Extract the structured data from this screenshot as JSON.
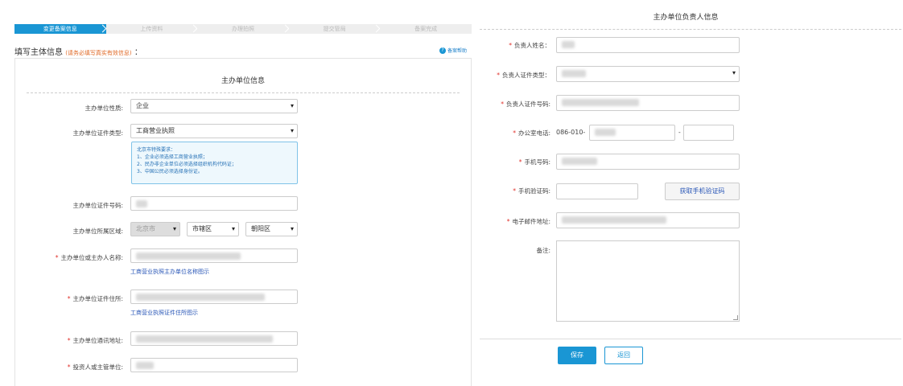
{
  "steps": [
    "变更备案信息",
    "上传资料",
    "办理拍照",
    "提交管局",
    "备案完成"
  ],
  "left": {
    "fill_title": "填写主体信息",
    "fill_hint": "(请务必填写真实有效信息)",
    "fill_colon": "：",
    "help_icon": "?",
    "help_label": "备案帮助",
    "section_title": "主办单位信息",
    "nature_label": "主办单位性质:",
    "nature_value": "企业",
    "cert_type_label": "主办单位证件类型:",
    "cert_type_value": "工商营业执照",
    "notice_lines": [
      "北京市特殊要求：",
      "1、企业必须选择工商营业执照；",
      "2、民办非企业单位必须选择组织机构代码证；",
      "3、中国公民必须选择身份证。"
    ],
    "cert_no_label": "主办单位证件号码:",
    "region_label": "主办单位所属区域:",
    "region_province": "北京市",
    "region_city": "市辖区",
    "region_district": "朝阳区",
    "name_label": "主办单位或主办人名称:",
    "name_link": "工商营业执照主办单位名称图示",
    "addr_label": "主办单位证件住所:",
    "addr_link": "工商营业执照证件住所图示",
    "mail_addr_label": "主办单位通讯地址:",
    "investor_label": "投资人或主管单位:"
  },
  "right": {
    "title": "主办单位负责人信息",
    "name_label": "负责人姓名：",
    "cert_type_label": "负责人证件类型：",
    "cert_no_label": "负责人证件号码:",
    "phone_label": "办公室电话:",
    "phone_prefix": "086-010-",
    "phone_dash": "-",
    "mobile_label": "手机号码:",
    "code_label": "手机验证码:",
    "get_code_button": "获取手机验证码",
    "email_label": "电子邮件地址:",
    "remark_label": "备注:",
    "save_button": "保存",
    "back_button": "返回"
  },
  "colors": {
    "accent": "#1a96d4",
    "required": "#e0302a",
    "hint": "#e06a27",
    "link": "#2a57b7"
  }
}
